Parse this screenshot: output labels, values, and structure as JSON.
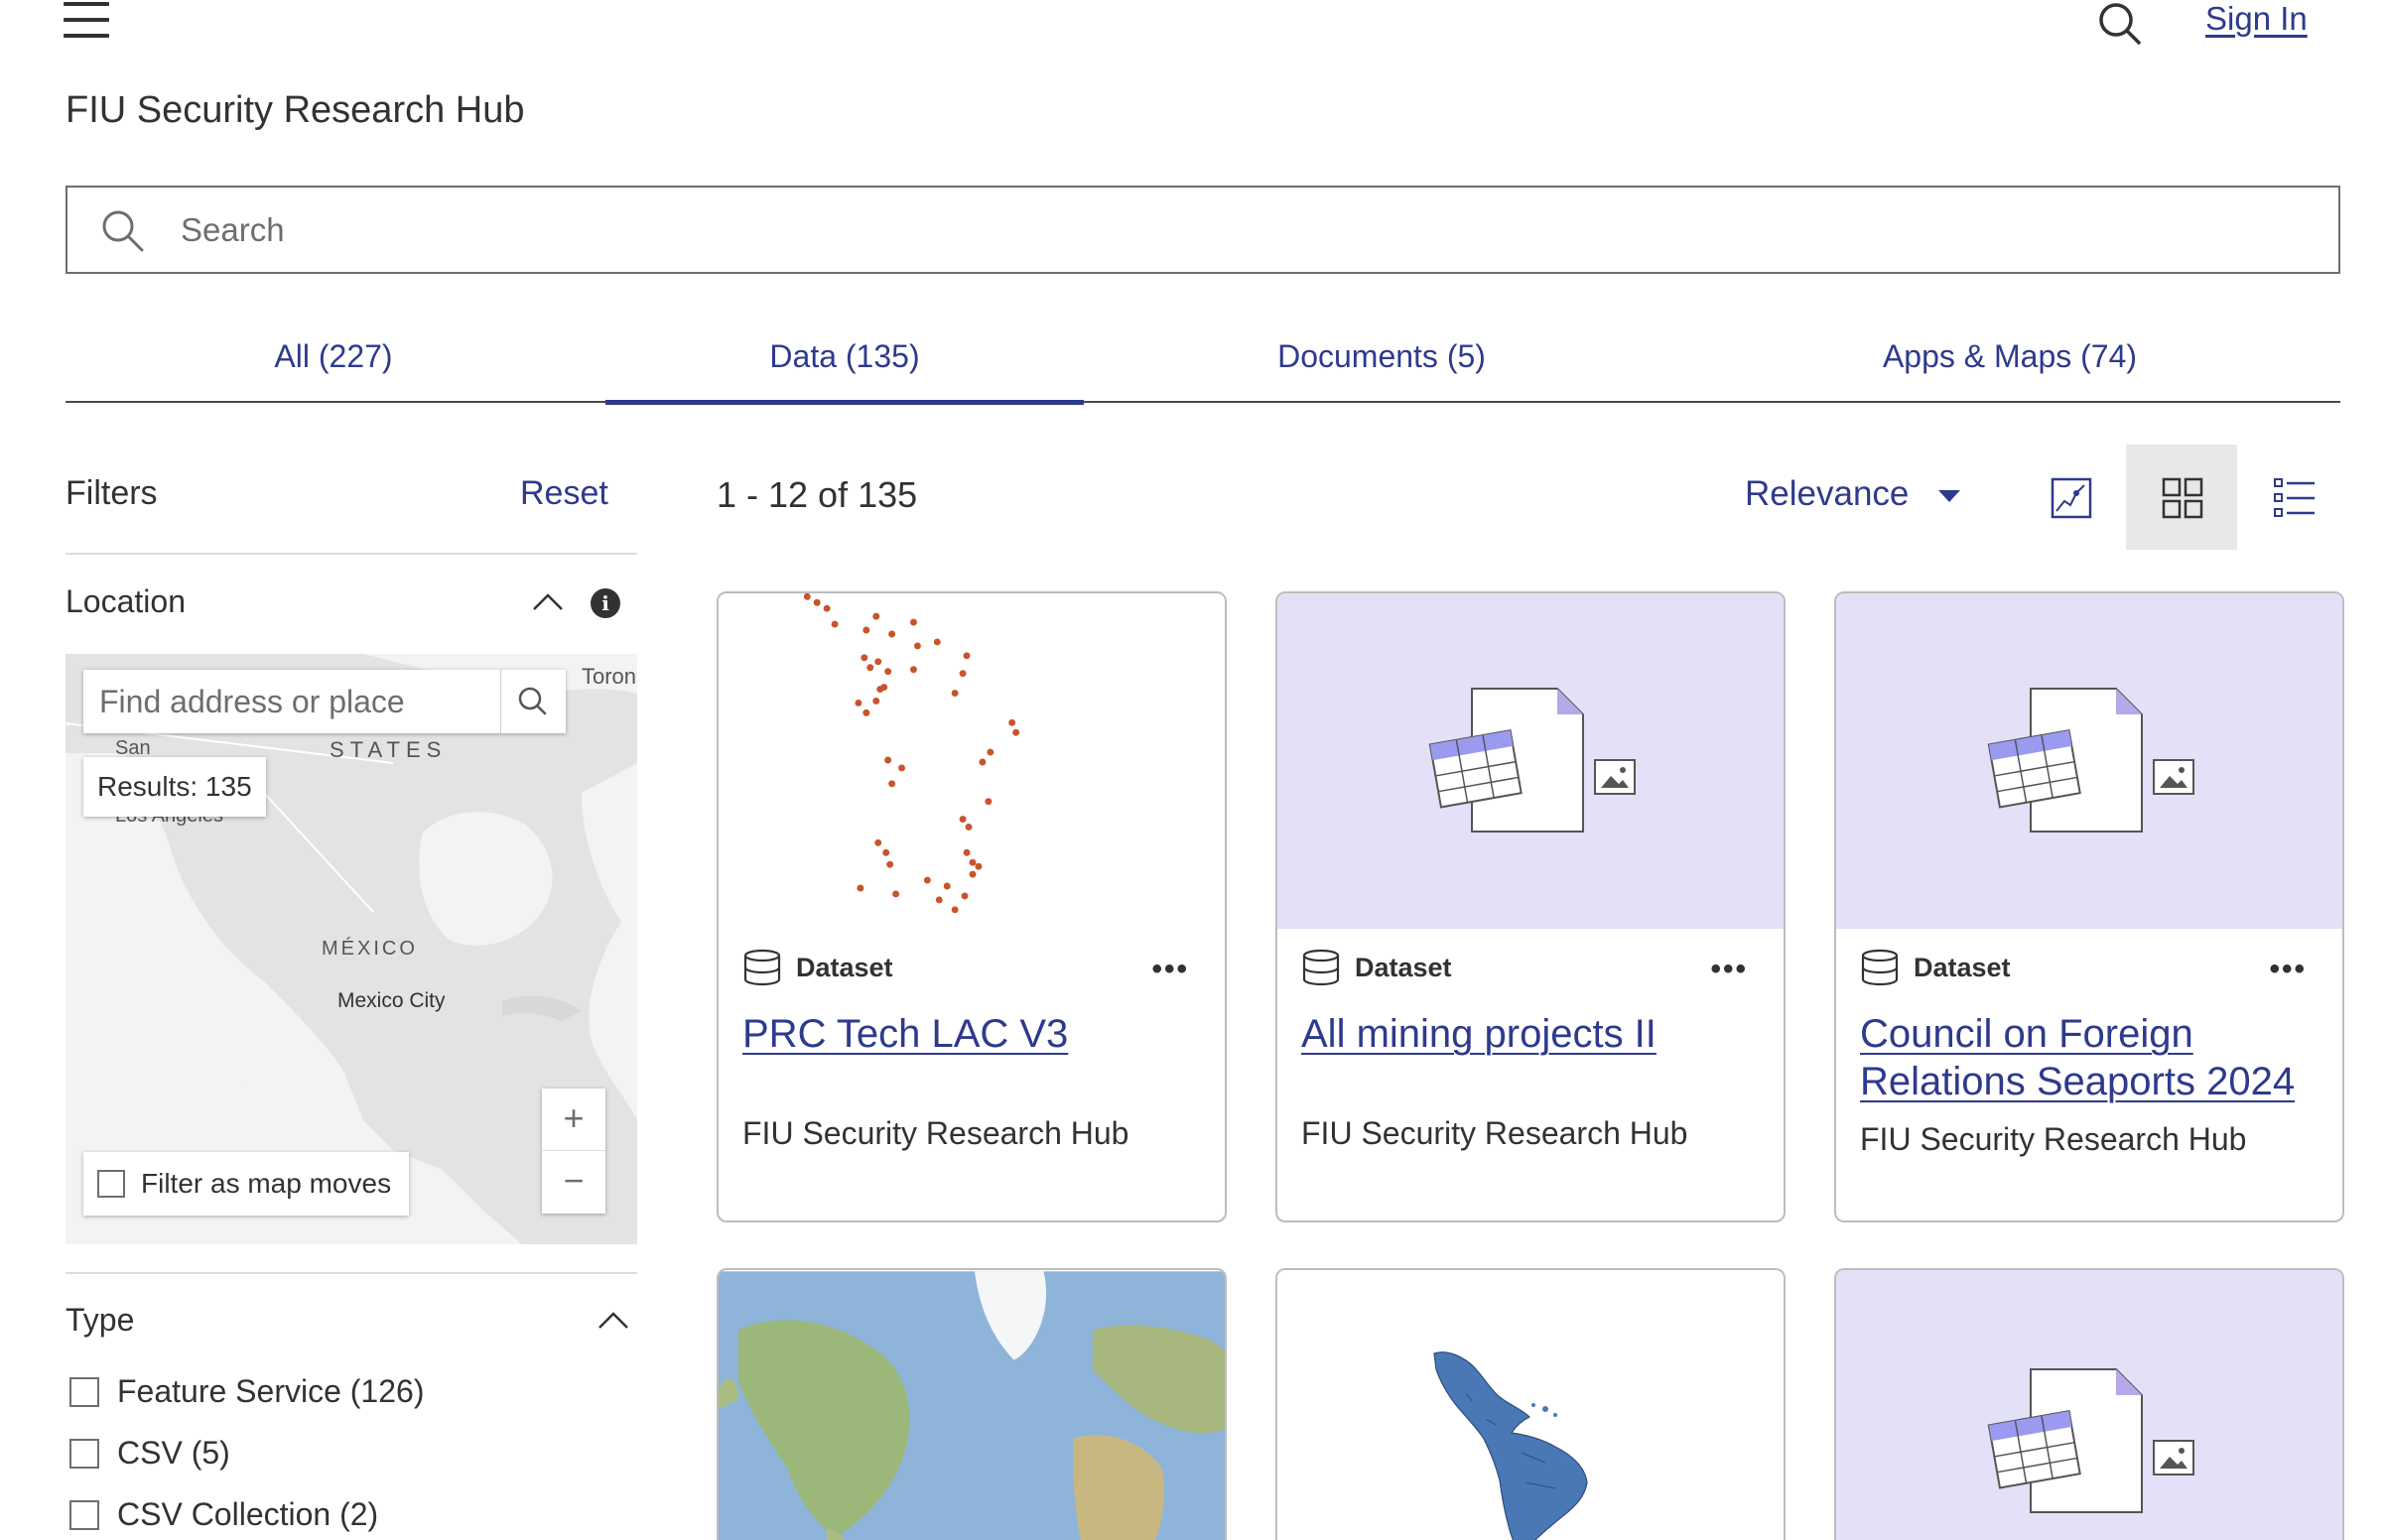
{
  "header": {
    "signin_label": "Sign In",
    "site_title": "FIU Security Research Hub"
  },
  "search": {
    "placeholder": "Search",
    "value": ""
  },
  "tabs": [
    {
      "label": "All (227)",
      "active": false
    },
    {
      "label": "Data (135)",
      "active": true
    },
    {
      "label": "Documents (5)",
      "active": false
    },
    {
      "label": "Apps & Maps (74)",
      "active": false
    }
  ],
  "filters": {
    "title": "Filters",
    "reset_label": "Reset",
    "location": {
      "title": "Location",
      "map": {
        "search_placeholder": "Find address or place",
        "results_label": "Results: 135",
        "filter_label": "Filter as map moves",
        "zoom_in": "+",
        "zoom_out": "−",
        "labels": {
          "toronto": "Toron",
          "states": "STATES",
          "san": "San",
          "los_angeles": "Los Angeles",
          "mexico": "MÉXICO",
          "mexico_city": "Mexico City"
        }
      }
    },
    "type": {
      "title": "Type",
      "options": [
        {
          "label": "Feature Service (126)",
          "checked": false
        },
        {
          "label": "CSV (5)",
          "checked": false
        },
        {
          "label": "CSV Collection (2)",
          "checked": false
        }
      ]
    }
  },
  "results": {
    "count_label": "1 - 12 of 135",
    "sort_label": "Relevance",
    "view_mode": "grid"
  },
  "cards": [
    {
      "type_label": "Dataset",
      "title": "PRC Tech LAC V3",
      "source": "FIU Security Research Hub",
      "thumb": "dot-map"
    },
    {
      "type_label": "Dataset",
      "title": "All mining projects II",
      "source": "FIU Security Research Hub",
      "thumb": "placeholder"
    },
    {
      "type_label": "Dataset",
      "title": "Council on Foreign Relations Seaports 2024",
      "source": "FIU Security Research Hub",
      "thumb": "placeholder"
    },
    {
      "thumb": "world-map"
    },
    {
      "thumb": "latin-america-map"
    },
    {
      "thumb": "placeholder"
    }
  ],
  "icons": {
    "menu": "hamburger-icon",
    "search": "search-icon",
    "info": "info-icon",
    "dataset": "database-icon",
    "more": "more-icon",
    "map_view": "map-view-icon",
    "grid_view": "grid-view-icon",
    "list_view": "list-view-icon"
  },
  "colors": {
    "accent": "#2e3a8c",
    "placeholder_bg": "#e3e1f7",
    "dot": "#c8542c",
    "map_bg": "#e2e3e3"
  }
}
